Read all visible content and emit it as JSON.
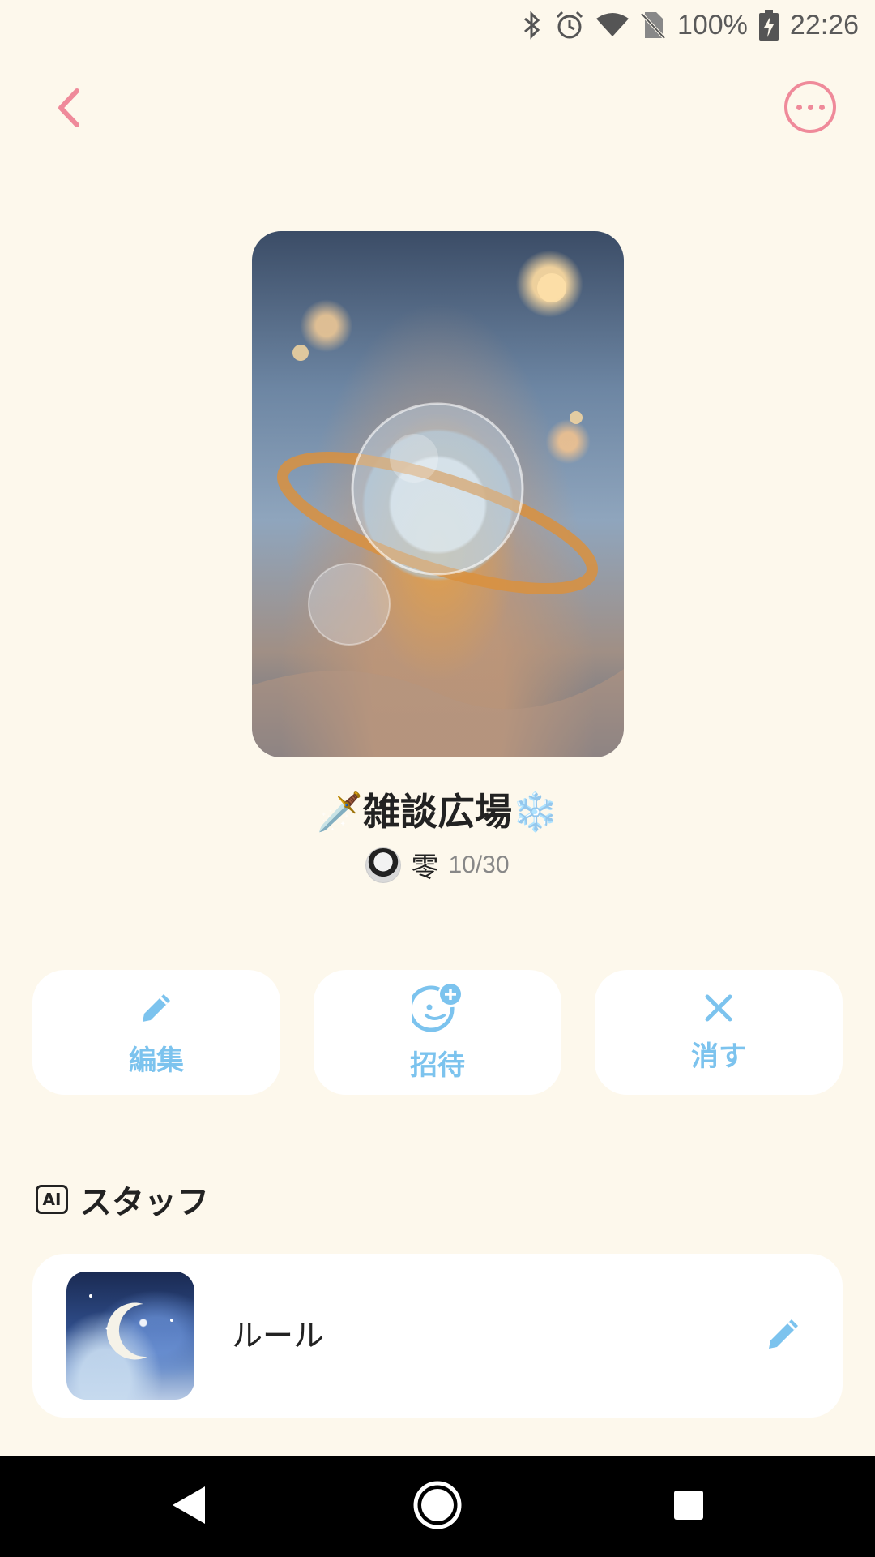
{
  "status_bar": {
    "battery": "100%",
    "time": "22:26",
    "icons": [
      "bluetooth-icon",
      "alarm-icon",
      "wifi-icon",
      "no-sim-icon",
      "battery-charging-icon"
    ]
  },
  "header": {
    "back_icon": "chevron-left-icon",
    "more_icon": "more-horizontal-icon",
    "accent_color": "#ef8a9a"
  },
  "chat": {
    "title": "🗡️雑談広場❄️",
    "owner_name": "零",
    "member_count": "10/30"
  },
  "actions": [
    {
      "label": "編集",
      "icon": "pencil-icon"
    },
    {
      "label": "招待",
      "icon": "invite-face-icon"
    },
    {
      "label": "消す",
      "icon": "close-icon"
    }
  ],
  "staff_section": {
    "badge": "AI",
    "title": "スタッフ",
    "items": [
      {
        "name": "ルール",
        "icon": "pencil-icon"
      }
    ]
  },
  "colors": {
    "background": "#fdf8ec",
    "action_blue": "#7cc3ee"
  }
}
